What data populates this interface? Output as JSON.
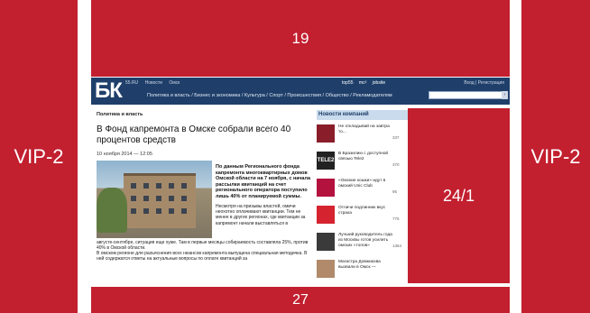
{
  "banners": {
    "left": "VIP-2",
    "right": "VIP-2",
    "top": "19",
    "middle": "24/1",
    "bottom": "27"
  },
  "site": {
    "logo": "БК",
    "toplinks": [
      "55.RU",
      "Новости",
      "Омск"
    ],
    "partners": [
      "top55",
      "mc²",
      "jobsite"
    ],
    "login": "Вход | Регистрация",
    "nav": "Политика и власть / Бизнес и экономика / Культура / Спорт / Происшествия / Общество / Рекламодателям",
    "search_button": "›",
    "breadcrumb": "Политика и власть",
    "headline": "В Фонд капремонта в Омске собрали всего 40 процентов средств",
    "date": "10 ноября 2014 — 12:05",
    "lead": "По данным Регионального фонда капремонта многоквартирных домов Омской области на 7 ноября, с начала рассылки квитанций на счет регионального оператора поступило лишь 40% от планируемой суммы.",
    "para1": "Несмотря на призывы властей, омичи неохотно оплачивают квитанции. Тем не менее в других регионах, где квитанции за капремонт начали выставляться в",
    "para2": "августе-сентябре, ситуация еще хуже. Там в первые месяцы собираемость составляла 25%, против 40% в Омской области.",
    "para3": "В омском регионе для разъяснения всех нюансов капремонта выпущена специальная методичка. В ней содержатся ответы на актуальные вопросы по оплате квитанций за"
  },
  "companies": {
    "title": "Новости компаний",
    "items": [
      {
        "logo": "",
        "text": "Не откладывай на завтра то...",
        "count": "337",
        "color": "#8a1d2a"
      },
      {
        "logo": "TELE2",
        "text": "В Бразилию с доступной связью Tele2",
        "count": "370",
        "color": "#222222"
      },
      {
        "logo": "",
        "text": "«Омские кошки» идут в омский Unic Club",
        "count": "95",
        "color": "#b3123f"
      },
      {
        "logo": "",
        "text": "Отличи подлинник вкус страха",
        "count": "775",
        "color": "#d5232f"
      },
      {
        "logo": "",
        "text": "Лучший руководитель года из Москвы готов усилить омских «топов»",
        "count": "1364",
        "color": "#3a3a3a"
      },
      {
        "logo": "",
        "text": "Магистра Довжикова вызвали в Омск —",
        "count": "",
        "color": "#b08a6a"
      }
    ]
  }
}
